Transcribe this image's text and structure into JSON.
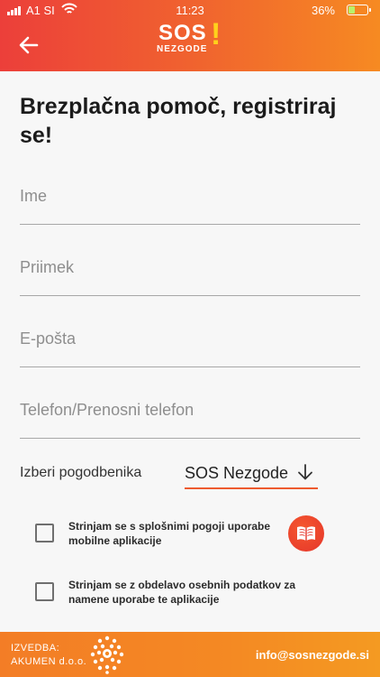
{
  "status_bar": {
    "carrier": "A1 SI",
    "time": "11:23",
    "battery": "36%",
    "battery_level": 0.36
  },
  "header": {
    "logo_text": "SOS",
    "logo_mark": "!",
    "logo_subtext": "NEZGODE",
    "back_icon": "arrow-left-icon"
  },
  "form": {
    "title": "Brezplačna pomoč, registriraj se!",
    "fields": [
      {
        "placeholder": "Ime",
        "value": ""
      },
      {
        "placeholder": "Priimek",
        "value": ""
      },
      {
        "placeholder": "E-pošta",
        "value": ""
      },
      {
        "placeholder": "Telefon/Prenosni telefon",
        "value": ""
      }
    ],
    "contractor": {
      "label": "Izberi pogodbenika",
      "selected": "SOS Nezgode",
      "icon": "arrow-down-icon"
    },
    "consents": [
      {
        "text": "Strinjam se s splošnimi pogoji uporabe mobilne aplikacije",
        "checked": false
      },
      {
        "text": "Strinjam se z obdelavo osebnih podatkov za namene uporabe te aplikacije",
        "checked": false
      }
    ],
    "terms_icon": "book-icon"
  },
  "footer": {
    "line1": "IZVEDBA:",
    "line2": "AKUMEN d.o.o.",
    "email": "info@sosnezgode.si"
  },
  "colors": {
    "accent": "#ee5a2e",
    "header_start": "#ec3f3a",
    "header_end": "#f68a22",
    "logo_mark": "#ffd11c"
  }
}
